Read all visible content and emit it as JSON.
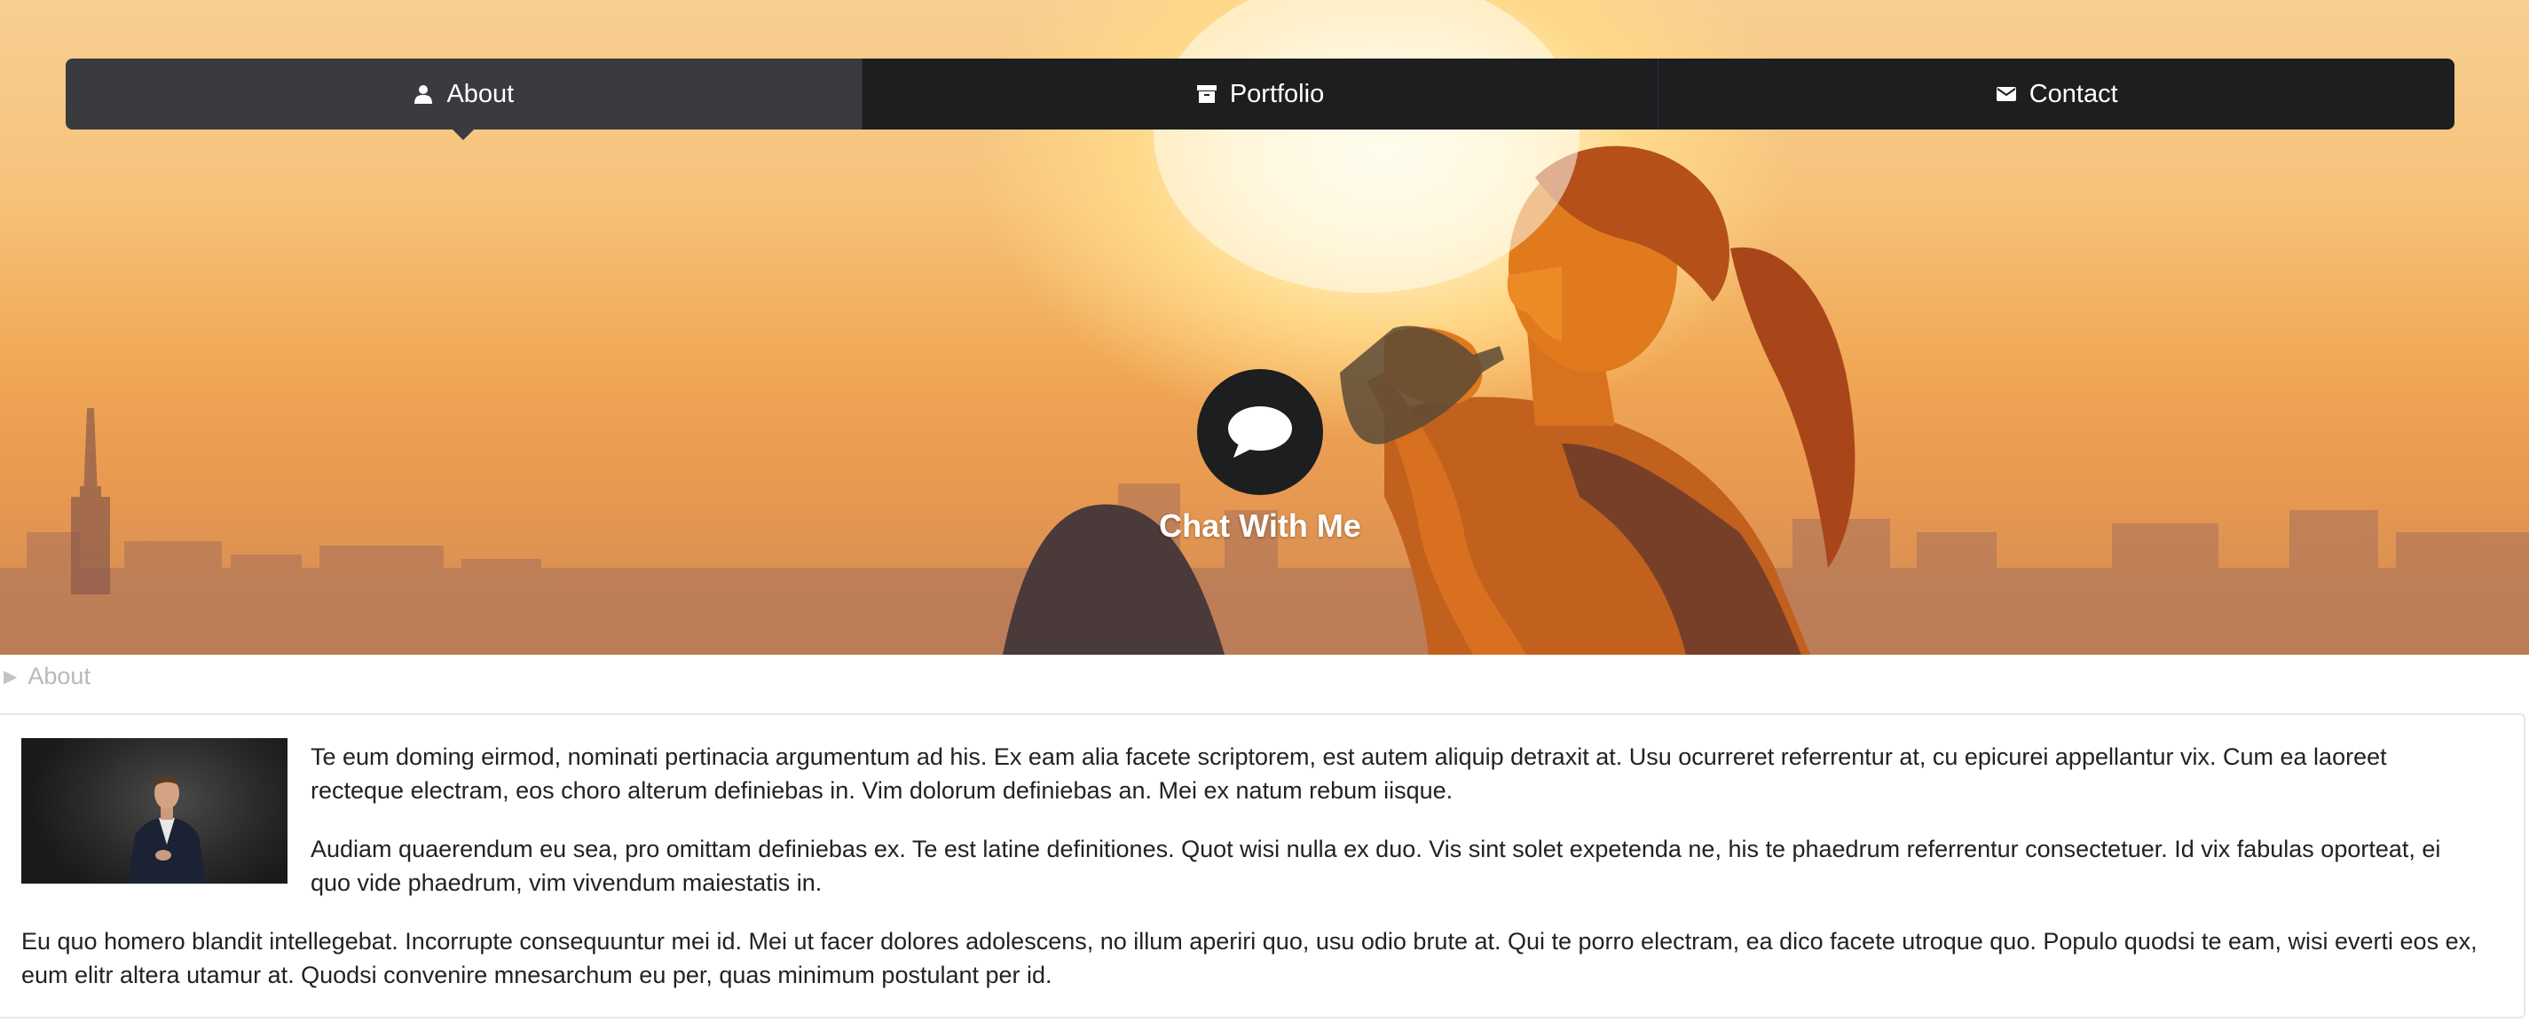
{
  "nav": {
    "items": [
      {
        "label": "About",
        "icon": "user-icon",
        "active": true
      },
      {
        "label": "Portfolio",
        "icon": "archive-icon",
        "active": false
      },
      {
        "label": "Contact",
        "icon": "envelope-icon",
        "active": false
      }
    ]
  },
  "hero": {
    "chat_label": "Chat With Me",
    "chat_icon": "comment-icon"
  },
  "breadcrumb": {
    "label": "About"
  },
  "about": {
    "photo_icon": "profile-photo",
    "paragraphs": [
      "Te eum doming eirmod, nominati pertinacia argumentum ad his. Ex eam alia facete scriptorem, est autem aliquip detraxit at. Usu ocurreret referrentur at, cu epicurei appellantur vix. Cum ea laoreet recteque electram, eos choro alterum definiebas in. Vim dolorum definiebas an. Mei ex natum rebum iisque.",
      "Audiam quaerendum eu sea, pro omittam definiebas ex. Te est latine definitiones. Quot wisi nulla ex duo. Vis sint solet expetenda ne, his te phaedrum referrentur consectetuer. Id vix fabulas oporteat, ei quo vide phaedrum, vim vivendum maiestatis in.",
      "Eu quo homero blandit intellegebat. Incorrupte consequuntur mei id. Mei ut facer dolores adolescens, no illum aperiri quo, usu odio brute at. Qui te porro electram, ea dico facete utroque quo. Populo quodsi te eam, wisi everti eos ex, eum elitr altera utamur at. Quodsi convenire mnesarchum eu per, quas minimum postulant per id."
    ]
  },
  "colors": {
    "nav_bg": "#1d1e20",
    "nav_active": "#3a3b3e",
    "text": "#222222",
    "muted": "#b9b9b9"
  }
}
